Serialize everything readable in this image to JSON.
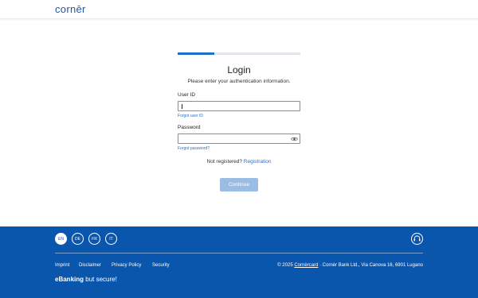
{
  "header": {
    "logo_text": "cornēr"
  },
  "login": {
    "progress_fraction": 0.3,
    "title": "Login",
    "subtitle": "Please enter your authentication information.",
    "user_id_label": "User ID",
    "user_id_value": "",
    "forgot_user_id": "Forgot user ID",
    "password_label": "Password",
    "password_value": "",
    "forgot_password": "Forgot password?",
    "not_registered": "Not registered?",
    "registration_link": "Registration",
    "continue_label": "Continue"
  },
  "footer": {
    "languages": [
      "EN",
      "DE",
      "FR",
      "IT"
    ],
    "active_language": "EN",
    "links": [
      "Imprint",
      "Disclaimer",
      "Privacy Policy",
      "Security"
    ],
    "copyright_prefix": "© 2025",
    "copyright_brand": "Cornèrcard",
    "copyright_suffix": " · Cornèr Bank Ltd., Via Canova 16, 6901 Lugano",
    "tagline_bold": "eBanking",
    "tagline_rest": " but secure!"
  },
  "colors": {
    "brand_blue": "#0b56ad",
    "link": "#2a6fc9",
    "button_disabled": "#9bbde3"
  }
}
